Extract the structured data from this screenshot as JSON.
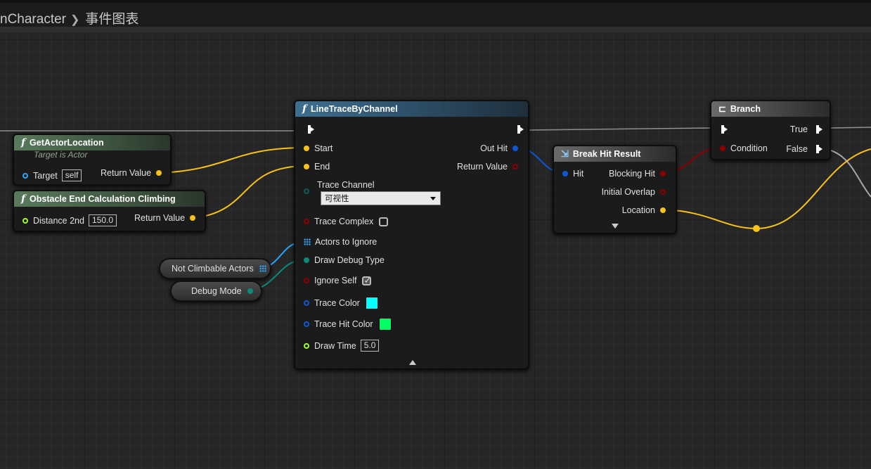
{
  "breadcrumb": {
    "parent": "nCharacter",
    "current": "事件图表"
  },
  "colors": {
    "exec_pin": "#ffffff",
    "vector_pin": "#f7c21a",
    "object_pin": "#2aa6ff",
    "struct_pin": "#0f58d4",
    "bool_pin": "#8d0000",
    "enum_pin": "#0a5c52",
    "float_pin": "#9cff33",
    "trace_color": "#00ffff",
    "trace_hit_color": "#00ff66"
  },
  "nodes": {
    "get_actor_location": {
      "title": "GetActorLocation",
      "subtitle": "Target is Actor",
      "target_label": "Target",
      "target_value": "self",
      "return_label": "Return Value"
    },
    "obstacle_end": {
      "title": "Obstacle End Calculation Climbing",
      "input_label": "Distance 2nd",
      "input_value": "150.0",
      "return_label": "Return Value"
    },
    "line_trace": {
      "title": "LineTraceByChannel",
      "start": "Start",
      "end": "End",
      "out_hit": "Out Hit",
      "return_value": "Return Value",
      "trace_channel_label": "Trace Channel",
      "trace_channel_value": "可视性",
      "trace_complex": "Trace Complex",
      "actors_to_ignore": "Actors to Ignore",
      "draw_debug_type": "Draw Debug Type",
      "ignore_self": "Ignore Self",
      "trace_color": "Trace Color",
      "trace_hit_color": "Trace Hit Color",
      "draw_time": "Draw Time",
      "draw_time_value": "5.0"
    },
    "break_hit": {
      "title": "Break Hit Result",
      "hit": "Hit",
      "blocking_hit": "Blocking Hit",
      "initial_overlap": "Initial Overlap",
      "location": "Location"
    },
    "branch": {
      "title": "Branch",
      "condition": "Condition",
      "true_label": "True",
      "false_label": "False"
    },
    "var_not_climbable": {
      "label": "Not Climbable Actors"
    },
    "var_debug_mode": {
      "label": "Debug Mode"
    }
  }
}
